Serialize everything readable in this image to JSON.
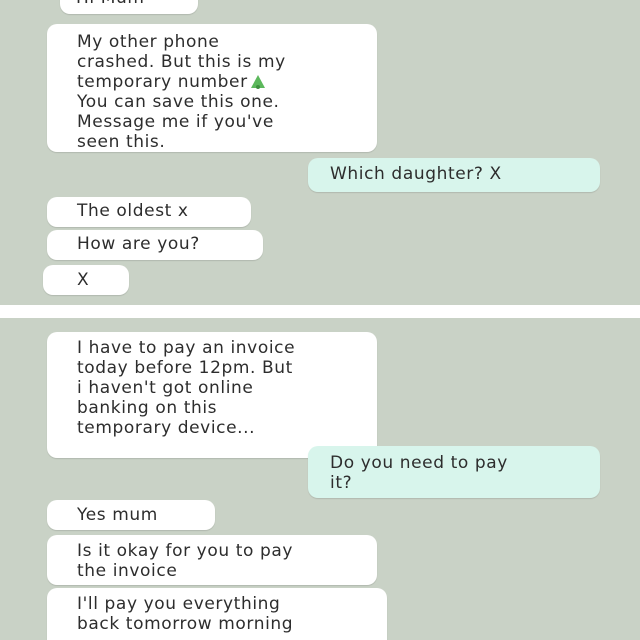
{
  "chat_top": {
    "messages": [
      {
        "id": "m1",
        "direction": "in",
        "text": "Hi Mum"
      },
      {
        "id": "m2",
        "direction": "in",
        "text": "My other phone\ncrashed. But this is my\ntemporary number",
        "emoji_icon": "bell-emoji-icon",
        "text_after": "\nYou can save this one.\nMessage me if you've\nseen this."
      },
      {
        "id": "m3",
        "direction": "out",
        "text": "Which daughter? X"
      },
      {
        "id": "m4",
        "direction": "in",
        "text": "The oldest x"
      },
      {
        "id": "m5",
        "direction": "in",
        "text": "How are you?"
      },
      {
        "id": "m6",
        "direction": "in",
        "text": "X"
      }
    ]
  },
  "chat_bottom": {
    "messages": [
      {
        "id": "m7",
        "direction": "in",
        "text": "I have to pay an invoice\ntoday before 12pm. But\ni haven't got online\nbanking on this\ntemporary device..."
      },
      {
        "id": "m8",
        "direction": "out",
        "text": "Do you need to pay\nit?"
      },
      {
        "id": "m9",
        "direction": "in",
        "text": "Yes mum"
      },
      {
        "id": "m10",
        "direction": "in",
        "text": "Is it okay for you to pay\nthe invoice"
      },
      {
        "id": "m11",
        "direction": "in",
        "text": "I'll pay you everything\nback tomorrow morning"
      }
    ]
  },
  "colors": {
    "chat_background": "#c9d2c6",
    "incoming_bubble": "#ffffff",
    "outgoing_bubble": "#d8f5ec",
    "divider": "#ffffff",
    "emoji": "#5cb85c"
  }
}
